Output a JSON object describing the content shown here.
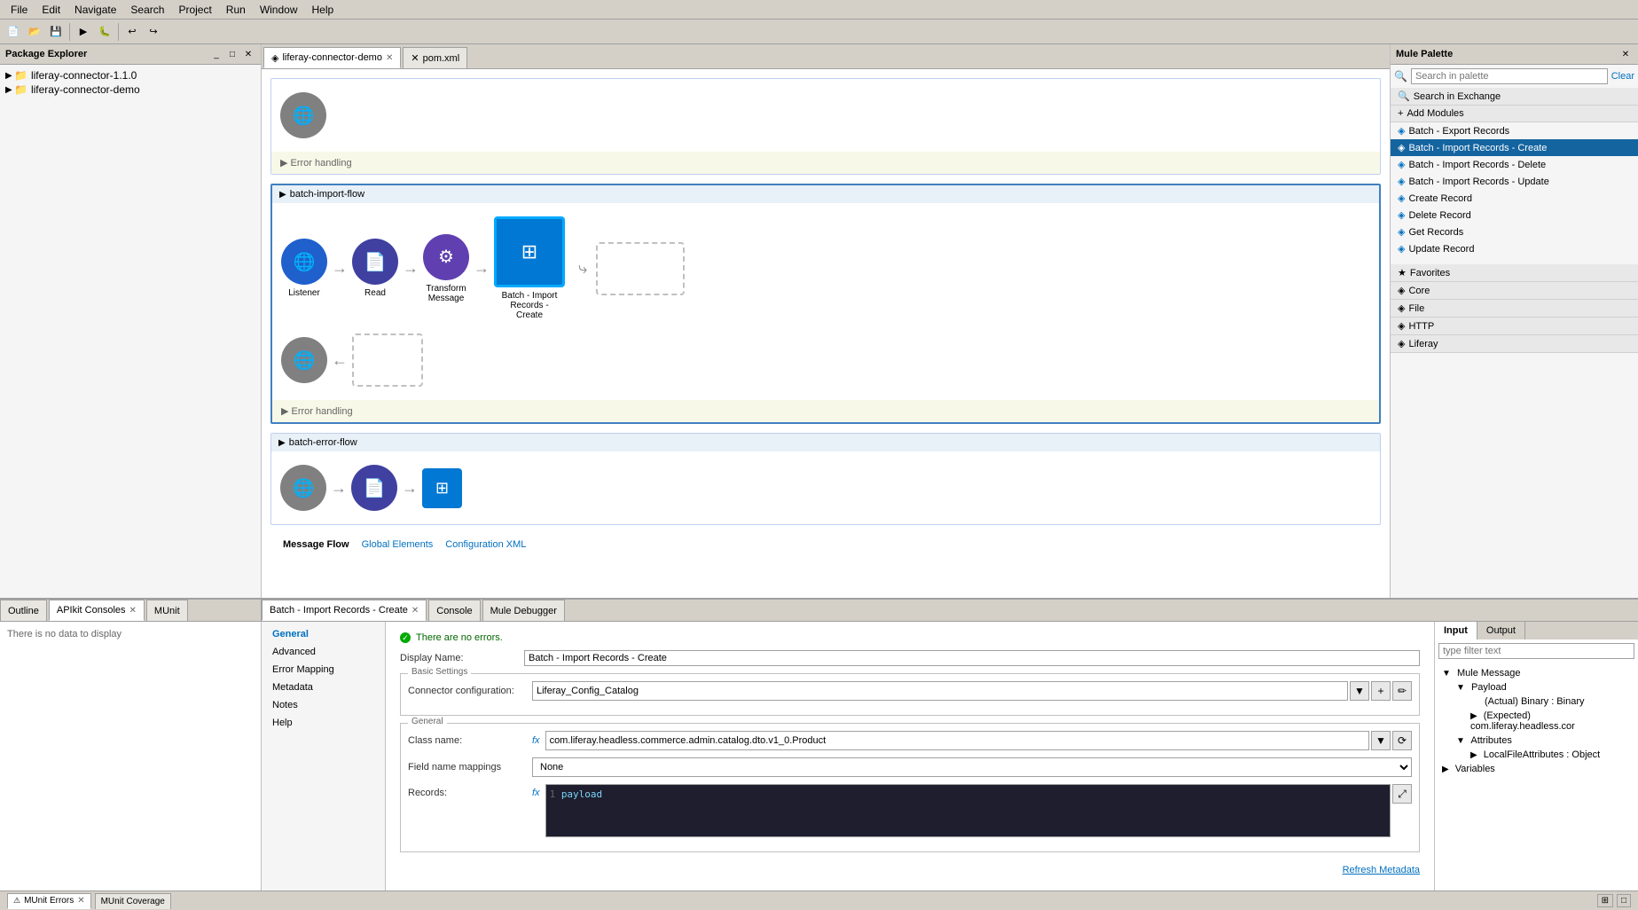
{
  "menubar": {
    "items": [
      "File",
      "Edit",
      "Navigate",
      "Search",
      "Project",
      "Run",
      "Window",
      "Help"
    ]
  },
  "tabs": {
    "main_tabs": [
      {
        "label": "liferay-connector-demo",
        "active": true,
        "closable": true,
        "icon": "◈"
      },
      {
        "label": "pom.xml",
        "active": false,
        "closable": true,
        "icon": "✕"
      }
    ]
  },
  "package_explorer": {
    "title": "Package Explorer",
    "items": [
      {
        "label": "liferay-connector-1.1.0",
        "level": 1,
        "expanded": true
      },
      {
        "label": "liferay-connector-demo",
        "level": 1,
        "expanded": false
      }
    ]
  },
  "flow_canvas": {
    "flows": [
      {
        "name": "batch-import-flow",
        "nodes": [
          {
            "label": "Listener",
            "type": "circle",
            "color": "#2060cc"
          },
          {
            "label": "Read",
            "type": "circle",
            "color": "#4040a0"
          },
          {
            "label": "Transform\nMessage",
            "type": "circle",
            "color": "#6040b0"
          },
          {
            "label": "Batch - Import\nRecords -\nCreate",
            "type": "box"
          }
        ]
      },
      {
        "name": "batch-error-flow",
        "nodes": [
          {
            "label": "",
            "type": "circle",
            "color": "#808080"
          },
          {
            "label": "",
            "type": "circle",
            "color": "#4040a0"
          },
          {
            "label": "",
            "type": "box-small"
          }
        ]
      }
    ],
    "bottom_links": [
      "Message Flow",
      "Global Elements",
      "Configuration XML"
    ]
  },
  "mule_palette": {
    "title": "Mule Palette",
    "search_placeholder": "Search in palette",
    "clear_label": "Clear",
    "categories": [
      {
        "label": "Search in Exchange",
        "icon": "🔍"
      },
      {
        "label": "Add Modules",
        "icon": "+"
      },
      {
        "label": "Favorites",
        "icon": "★"
      },
      {
        "label": "Core",
        "icon": "◈"
      },
      {
        "label": "File",
        "icon": "◈"
      },
      {
        "label": "HTTP",
        "icon": "◈"
      },
      {
        "label": "Liferay",
        "icon": "◈",
        "selected": true
      }
    ],
    "items": [
      {
        "label": "Batch - Export Records",
        "icon": "◈"
      },
      {
        "label": "Batch - Import Records - Create",
        "icon": "◈",
        "highlighted": true
      },
      {
        "label": "Batch - Import Records - Delete",
        "icon": "◈"
      },
      {
        "label": "Batch - Import Records - Update",
        "icon": "◈"
      },
      {
        "label": "Create Record",
        "icon": "◈"
      },
      {
        "label": "Delete Record",
        "icon": "◈"
      },
      {
        "label": "Get Records",
        "icon": "◈"
      },
      {
        "label": "Update Record",
        "icon": "◈"
      }
    ]
  },
  "config_panel": {
    "title": "Batch - Import Records - Create",
    "no_errors": "There are no errors.",
    "nav_items": [
      {
        "label": "General",
        "active": true
      },
      {
        "label": "Advanced"
      },
      {
        "label": "Error Mapping"
      },
      {
        "label": "Metadata"
      },
      {
        "label": "Notes"
      },
      {
        "label": "Help"
      }
    ],
    "display_name_label": "Display Name:",
    "display_name_value": "Batch - Import Records - Create",
    "basic_settings_label": "Basic Settings",
    "connector_config_label": "Connector configuration:",
    "connector_config_value": "Liferay_Config_Catalog",
    "general_label": "General",
    "class_name_label": "Class name:",
    "class_name_value": "com.liferay.headless.commerce.admin.catalog.dto.v1_0.Product",
    "field_name_mappings_label": "Field name mappings",
    "field_name_mappings_value": "None",
    "records_label": "Records:",
    "records_value": "payload",
    "refresh_metadata": "Refresh Metadata"
  },
  "right_side_panel": {
    "tabs": [
      "Input",
      "Output"
    ],
    "filter_placeholder": "type filter text",
    "tree": {
      "mule_message": "Mule Message",
      "payload": "Payload",
      "actual": "(Actual) Binary : Binary",
      "expected": "(Expected) com.liferay.headless.cor",
      "attributes": "Attributes",
      "local_file_attributes": "LocalFileAttributes : Object",
      "variables": "Variables"
    }
  },
  "bottom_tabs": [
    {
      "label": "Outline",
      "active": false
    },
    {
      "label": "APIkit Consoles",
      "active": true
    },
    {
      "label": "MUnit",
      "active": false
    }
  ],
  "bottom_left": {
    "message": "There is no data to display"
  },
  "bottom_tabs_right": [
    {
      "label": "Batch - Import Records - Create",
      "active": true,
      "closable": true
    },
    {
      "label": "Console",
      "active": false
    },
    {
      "label": "Mule Debugger",
      "active": false
    }
  ],
  "munit_bottom_tabs": [
    {
      "label": "MUnit Errors",
      "active": true,
      "closable": true
    },
    {
      "label": "MUnit Coverage",
      "active": false
    }
  ]
}
